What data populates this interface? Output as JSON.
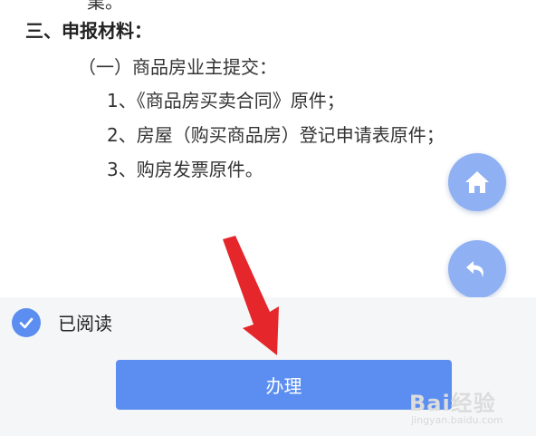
{
  "document": {
    "cut_text": "業。",
    "section_title": "三、申报材料：",
    "subheading": "（一）商品房业主提交：",
    "items": [
      "1、《商品房买卖合同》原件；",
      "2、房屋（购买商品房）登记申请表原件；",
      "3、购房发票原件。"
    ]
  },
  "agreement": {
    "checked": true,
    "label": "已阅读"
  },
  "action": {
    "submit_label": "办理"
  },
  "watermark": {
    "brand": "Bai经验",
    "url": "jingyan.baidu.com"
  },
  "colors": {
    "primary": "#5b8ef0",
    "fab": "#8fb0f2",
    "annotation_arrow": "#e5262a",
    "footer_bg": "#f5f6f8"
  },
  "icons": {
    "home": "home-icon",
    "back": "undo-arrow-icon",
    "check": "check-icon"
  }
}
